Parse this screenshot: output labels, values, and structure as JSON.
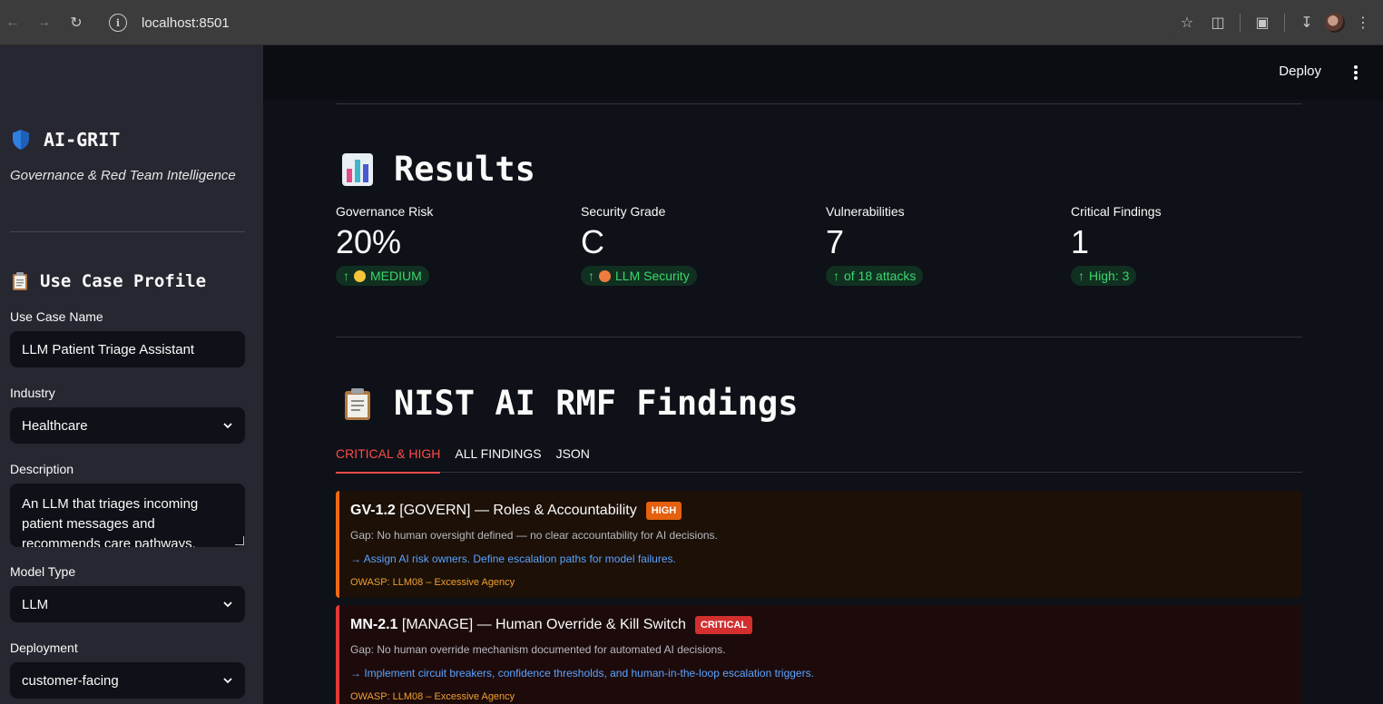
{
  "browser": {
    "url": "localhost:8501"
  },
  "sidebar": {
    "app_title": "AI-GRIT",
    "tagline": "Governance & Red Team Intelligence",
    "section_title": "Use Case Profile",
    "fields": {
      "use_case_name": {
        "label": "Use Case Name",
        "value": "LLM Patient Triage Assistant"
      },
      "industry": {
        "label": "Industry",
        "value": "Healthcare"
      },
      "description": {
        "label": "Description",
        "value": "An LLM that triages incoming patient messages and recommends care pathways."
      },
      "model_type": {
        "label": "Model Type",
        "value": "LLM"
      },
      "deployment": {
        "label": "Deployment",
        "value": "customer-facing"
      }
    }
  },
  "header": {
    "deploy_label": "Deploy"
  },
  "results": {
    "title": "Results",
    "metrics": [
      {
        "label": "Governance Risk",
        "value": "20%",
        "delta": "MEDIUM",
        "delta_dot_color": "#f6c33a"
      },
      {
        "label": "Security Grade",
        "value": "C",
        "delta": "LLM Security",
        "delta_dot_color": "#f07b3f"
      },
      {
        "label": "Vulnerabilities",
        "value": "7",
        "delta": "of 18 attacks"
      },
      {
        "label": "Critical Findings",
        "value": "1",
        "delta": "High: 3"
      }
    ]
  },
  "findings": {
    "title": "NIST AI RMF Findings",
    "tabs": [
      "CRITICAL & HIGH",
      "ALL FINDINGS",
      "JSON"
    ],
    "active_tab": 0,
    "items": [
      {
        "code": "GV-1.2",
        "title": "[GOVERN] — Roles & Accountability",
        "severity": "HIGH",
        "gap": "Gap: No human oversight defined — no clear accountability for AI decisions.",
        "recommendation": "→ Assign AI risk owners. Define escalation paths for model failures.",
        "owasp": "OWASP: LLM08 – Excessive Agency"
      },
      {
        "code": "MN-2.1",
        "title": "[MANAGE] — Human Override & Kill Switch",
        "severity": "CRITICAL",
        "gap": "Gap: No human override mechanism documented for automated AI decisions.",
        "recommendation": "→ Implement circuit breakers, confidence thresholds, and human-in-the-loop escalation triggers.",
        "owasp": "OWASP: LLM08 – Excessive Agency"
      }
    ]
  },
  "colors": {
    "accent": "#ff4b4b",
    "delta_green": "#3dd56d",
    "high": "#f06a14",
    "critical": "#e53935",
    "link": "#5aa3ff"
  }
}
